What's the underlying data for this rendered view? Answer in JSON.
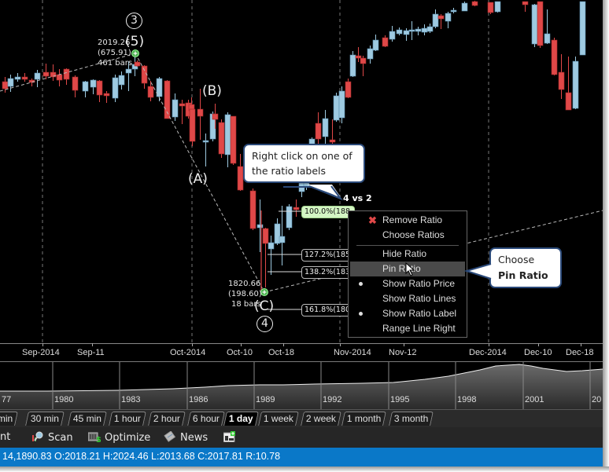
{
  "chart": {
    "instrument_timeframe": "1 day",
    "candle_colors": {
      "up": "#9ecae1",
      "down": "#e04848"
    },
    "pivots": {
      "p3": {
        "price": "2019.26",
        "change": "(675.91)",
        "bars": "461 bars",
        "wave_circle": "3",
        "wave_paren": "(5)"
      },
      "p4": {
        "price": "1820.66",
        "change": "(198.60)",
        "bars": "18 bars",
        "wave_circle": "4",
        "wave_paren": "(C)"
      },
      "wave_a": "(A)",
      "wave_b": "(B)"
    },
    "ratio_title": "4 vs 2",
    "ratios": [
      {
        "label": "100.0%(188",
        "active": true
      },
      {
        "label": "127.2%(185",
        "active": false
      },
      {
        "label": "138.2%(183",
        "active": false
      },
      {
        "label": "161.8%(180",
        "active": false
      }
    ],
    "x_axis_labels": [
      "Sep-2014",
      "Sep-11",
      "Oct-2014",
      "Oct-10",
      "Oct-18",
      "Nov-2014",
      "Nov-12",
      "Dec-2014",
      "Dec-10",
      "Dec-18"
    ],
    "overview_years": [
      "77",
      "1980",
      "1983",
      "1986",
      "1989",
      "1992",
      "1995",
      "1998",
      "2001",
      "20"
    ]
  },
  "callouts": {
    "right_click": "Right click on one of the ratio labels",
    "choose_line1": "Choose",
    "choose_line2": "Pin Ratio"
  },
  "context_menu": {
    "items": [
      {
        "label": "Remove Ratio",
        "icon": "x-icon"
      },
      {
        "label": "Choose Ratios"
      },
      {
        "label": "Hide Ratio"
      },
      {
        "label": "Pin Ratio",
        "highlighted": true
      },
      {
        "label": "Show Ratio Price",
        "checked": true
      },
      {
        "label": "Show Ratio Lines"
      },
      {
        "label": "Show Ratio Label",
        "checked": true
      },
      {
        "label": "Range Line Right"
      }
    ]
  },
  "timeframe_tabs": [
    {
      "label": "min"
    },
    {
      "label": "30 min"
    },
    {
      "label": "45 min"
    },
    {
      "label": "1 hour"
    },
    {
      "label": "2 hour"
    },
    {
      "label": "6 hour"
    },
    {
      "label": "1 day",
      "selected": true
    },
    {
      "label": "1 week"
    },
    {
      "label": "2 week"
    },
    {
      "label": "1 month"
    },
    {
      "label": "3 month"
    }
  ],
  "toolbar": {
    "items": [
      {
        "label": "nt"
      },
      {
        "label": "Scan",
        "icon": "scan-icon"
      },
      {
        "label": "Optimize",
        "icon": "optimize-icon"
      },
      {
        "label": "News",
        "icon": "news-icon"
      },
      {
        "label": "",
        "icon": "add-layout-icon"
      }
    ]
  },
  "status_bar": {
    "text": "14,1890.83 O:2018.21 H:2024.46 L:2013.68 C:2017.81 R:10.78"
  }
}
